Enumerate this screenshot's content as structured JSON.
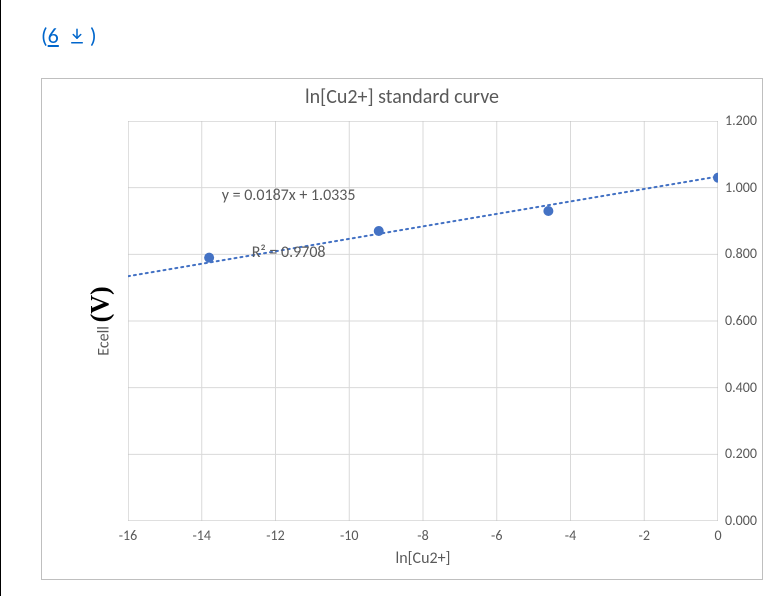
{
  "header": {
    "link_prefix": "(",
    "link_text": "6",
    "link_suffix": ")",
    "download_icon": "download-icon"
  },
  "chart": {
    "title": "ln[Cu2+] standard curve",
    "xlabel": "ln[Cu2+]",
    "ylabel_main": "Ecell",
    "ylabel_unit": "(V)",
    "equation_line1": "y = 0.0187x + 1.0335",
    "equation_line2": "R² = 0.9708",
    "yticks": {
      "t0": "0.000",
      "t1": "0.200",
      "t2": "0.400",
      "t3": "0.600",
      "t4": "0.800",
      "t5": "1.000",
      "t6": "1.200"
    },
    "xticks": {
      "xm16": "-16",
      "xm14": "-14",
      "xm12": "-12",
      "xm10": "-10",
      "xm8": "-8",
      "xm6": "-6",
      "xm4": "-4",
      "xm2": "-2",
      "x0": "0"
    }
  },
  "chart_data": {
    "type": "scatter",
    "title": "ln[Cu2+] standard curve",
    "xlabel": "ln[Cu2+]",
    "ylabel": "Ecell (V)",
    "xlim": [
      -16,
      0
    ],
    "ylim": [
      0,
      1.2
    ],
    "x": [
      -13.8,
      -9.2,
      -4.6,
      0.0
    ],
    "y": [
      0.79,
      0.87,
      0.93,
      1.03
    ],
    "trendline": {
      "type": "linear",
      "slope": 0.0187,
      "intercept": 1.0335,
      "r2": 0.9708,
      "display": "dotted"
    }
  }
}
